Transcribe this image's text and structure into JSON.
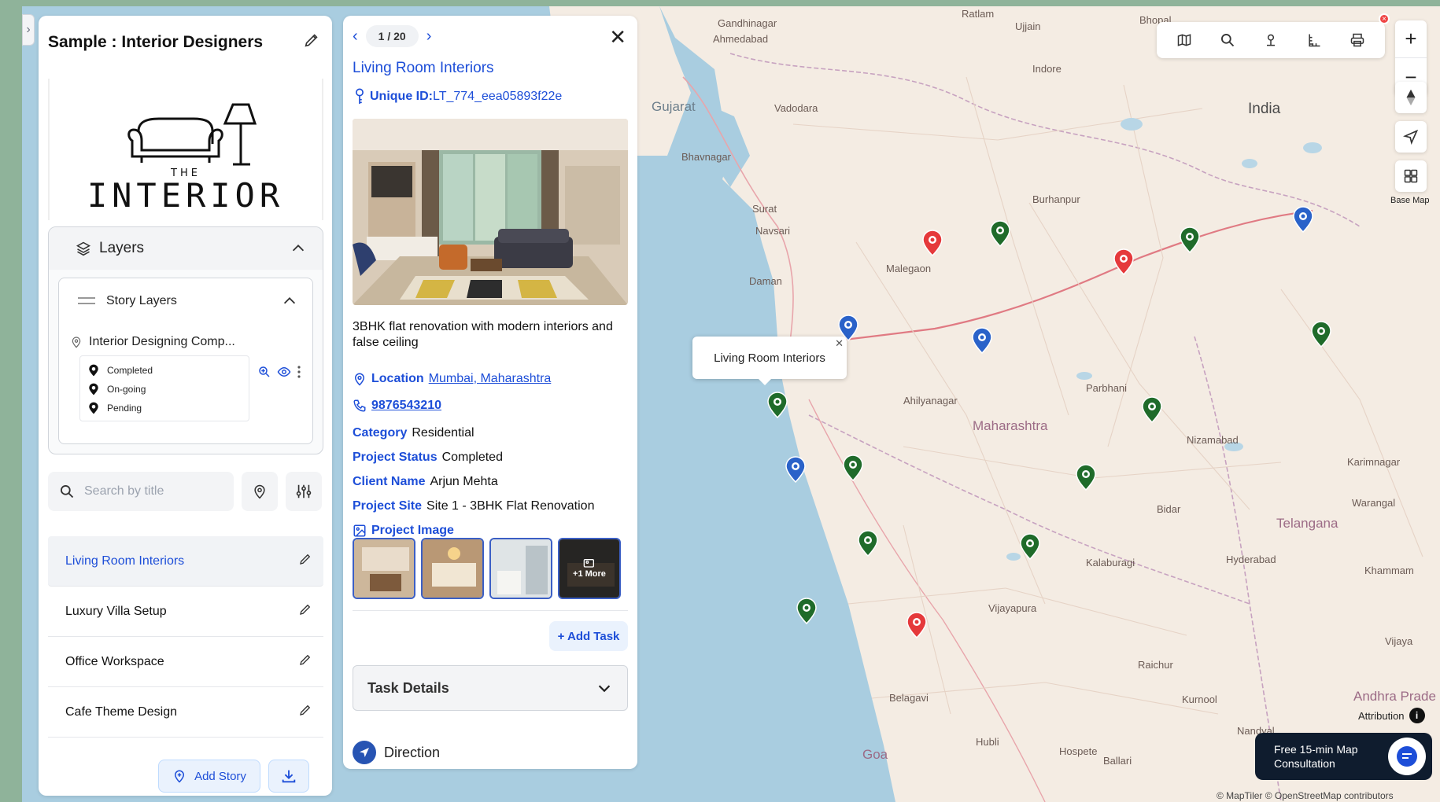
{
  "left_panel": {
    "story_title": "Sample : Interior Designers",
    "logo": {
      "top": "THE",
      "main": "INTERIOR"
    },
    "layers": {
      "title": "Layers",
      "story_layers_title": "Story Layers",
      "layer_name": "Interior Designing Comp...",
      "legend": [
        {
          "label": "Completed"
        },
        {
          "label": "On-going"
        },
        {
          "label": "Pending"
        }
      ]
    },
    "search": {
      "placeholder": "Search by title"
    },
    "stories": [
      {
        "name": "Living Room Interiors",
        "active": true
      },
      {
        "name": "Luxury Villa Setup",
        "active": false
      },
      {
        "name": "Office Workspace",
        "active": false
      },
      {
        "name": "Cafe Theme Design",
        "active": false
      }
    ],
    "add_story_label": "Add Story"
  },
  "detail": {
    "pager": "1 / 20",
    "title": "Living Room Interiors",
    "unique_id_label": "Unique ID:",
    "unique_id_value": "LT_774_eea05893f22e",
    "description": "3BHK flat renovation with modern interiors and false ceiling",
    "location_label": "Location",
    "location_value": "Mumbai, Maharashtra",
    "phone": "9876543210",
    "fields": [
      {
        "key": "Category",
        "value": "Residential"
      },
      {
        "key": "Project Status",
        "value": "Completed"
      },
      {
        "key": "Client Name",
        "value": "Arjun Mehta"
      },
      {
        "key": "Project Site",
        "value": "Site 1 - 3BHK Flat Renovation"
      }
    ],
    "project_image_label": "Project Image",
    "more_images_label": "+1 More",
    "add_task_label": "+ Add Task",
    "task_details_label": "Task Details",
    "direction_label": "Direction"
  },
  "map": {
    "popup_label": "Living Room Interiors",
    "places": [
      {
        "name": "Gandhinagar",
        "cls": ""
      },
      {
        "name": "Ahmedabad",
        "cls": ""
      },
      {
        "name": "Ratlam",
        "cls": ""
      },
      {
        "name": "Ujjain",
        "cls": ""
      },
      {
        "name": "Bhopal",
        "cls": ""
      },
      {
        "name": "Indore",
        "cls": ""
      },
      {
        "name": "Gujarat",
        "cls": "region"
      },
      {
        "name": "Vadodara",
        "cls": ""
      },
      {
        "name": "India",
        "cls": "big"
      },
      {
        "name": "Bhavnagar",
        "cls": ""
      },
      {
        "name": "Surat",
        "cls": ""
      },
      {
        "name": "Navsari",
        "cls": ""
      },
      {
        "name": "Burhanpur",
        "cls": ""
      },
      {
        "name": "Malegaon",
        "cls": ""
      },
      {
        "name": "Daman",
        "cls": ""
      },
      {
        "name": "Ahilyanagar",
        "cls": ""
      },
      {
        "name": "Parbhani",
        "cls": ""
      },
      {
        "name": "Maharashtra",
        "cls": "state"
      },
      {
        "name": "Nizamabad",
        "cls": ""
      },
      {
        "name": "Karimnagar",
        "cls": ""
      },
      {
        "name": "Warangal",
        "cls": ""
      },
      {
        "name": "Bidar",
        "cls": ""
      },
      {
        "name": "Telangana",
        "cls": "state"
      },
      {
        "name": "Hyderabad",
        "cls": ""
      },
      {
        "name": "Kalaburagi",
        "cls": ""
      },
      {
        "name": "Khammam",
        "cls": ""
      },
      {
        "name": "Vijayapura",
        "cls": ""
      },
      {
        "name": "Raichur",
        "cls": ""
      },
      {
        "name": "Vijaya",
        "cls": ""
      },
      {
        "name": "Andhra Prade",
        "cls": "state"
      },
      {
        "name": "Belagavi",
        "cls": ""
      },
      {
        "name": "Kurnool",
        "cls": ""
      },
      {
        "name": "Goa",
        "cls": "state"
      },
      {
        "name": "Hubli",
        "cls": ""
      },
      {
        "name": "Hospete",
        "cls": ""
      },
      {
        "name": "Ballari",
        "cls": ""
      },
      {
        "name": "Nandyal",
        "cls": ""
      }
    ],
    "markers": [
      {
        "status": "pending"
      },
      {
        "status": "completed"
      },
      {
        "status": "pending"
      },
      {
        "status": "completed"
      },
      {
        "status": "ongoing"
      },
      {
        "status": "ongoing"
      },
      {
        "status": "completed"
      },
      {
        "status": "completed"
      },
      {
        "status": "completed"
      },
      {
        "status": "ongoing"
      },
      {
        "status": "completed"
      },
      {
        "status": "completed"
      },
      {
        "status": "ongoing"
      },
      {
        "status": "completed"
      },
      {
        "status": "completed"
      },
      {
        "status": "completed"
      },
      {
        "status": "pending"
      }
    ],
    "toolbar_badge": "×",
    "base_map_label": "Base Map",
    "attribution_label": "Attribution",
    "consult_line1": "Free 15-min Map",
    "consult_line2": "Consultation",
    "osm_credit": "© MapTiler © OpenStreetMap contributors"
  },
  "colors": {
    "completed": "#1f6b2a",
    "ongoing": "#2a62c9",
    "pending": "#e5393b",
    "accent": "#1d4ed8"
  }
}
